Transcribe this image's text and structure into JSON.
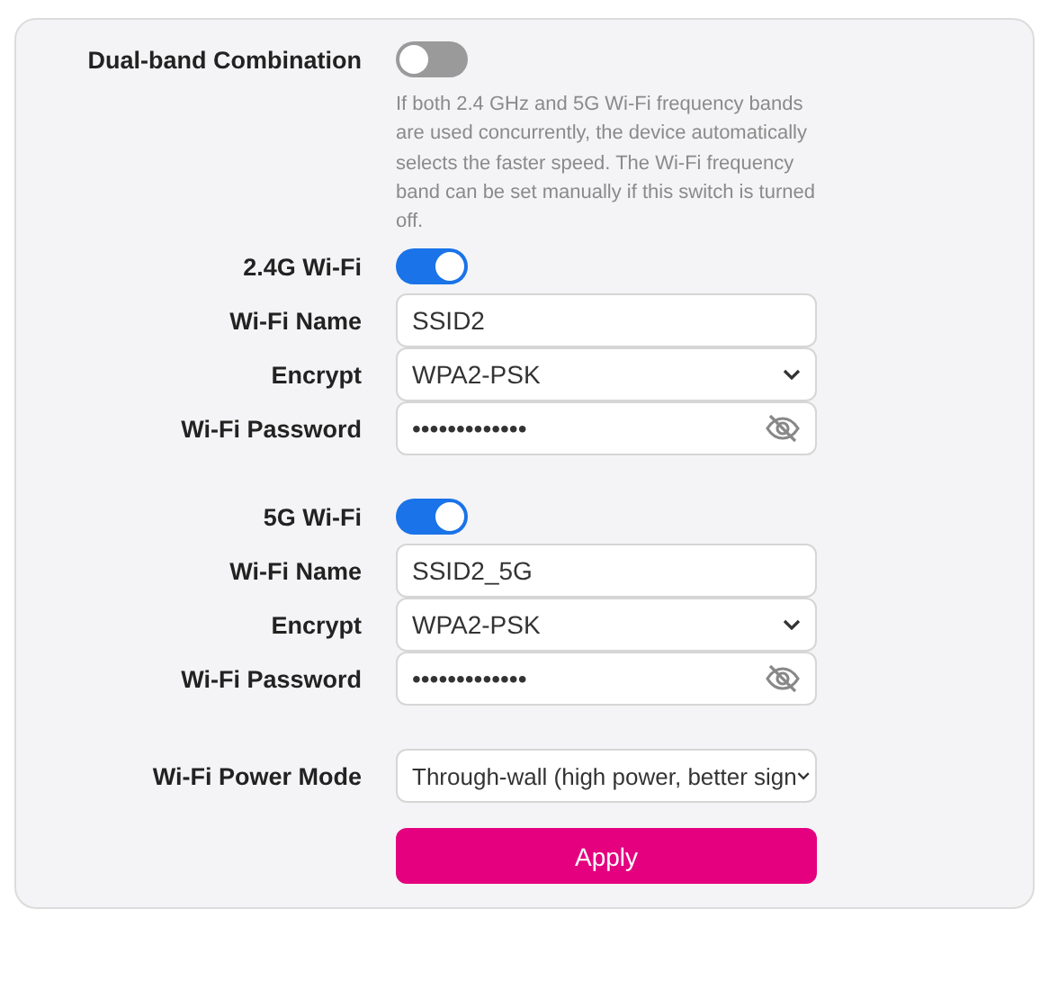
{
  "dual_band": {
    "label": "Dual-band Combination",
    "on": false,
    "description": "If both 2.4 GHz and 5G Wi-Fi frequency bands are used concurrently, the device automatically selects the faster speed. The Wi-Fi frequency band can be set manually if this switch is turned off."
  },
  "bands": [
    {
      "label": "2.4G Wi-Fi",
      "on": true,
      "fields": [
        {
          "kind": "text",
          "label": "Wi-Fi Name",
          "value": "SSID2"
        },
        {
          "kind": "select",
          "label": "Encrypt",
          "value": "WPA2-PSK"
        },
        {
          "kind": "password",
          "label": "Wi-Fi Password",
          "value": "•••••••••••••"
        }
      ]
    },
    {
      "label": "5G Wi-Fi",
      "on": true,
      "fields": [
        {
          "kind": "text",
          "label": "Wi-Fi Name",
          "value": "SSID2_5G"
        },
        {
          "kind": "select",
          "label": "Encrypt",
          "value": "WPA2-PSK"
        },
        {
          "kind": "password",
          "label": "Wi-Fi Password",
          "value": "•••••••••••••"
        }
      ]
    }
  ],
  "power_mode": {
    "label": "Wi-Fi Power Mode",
    "value": "Through-wall (high power, better sign"
  },
  "apply_button": "Apply"
}
